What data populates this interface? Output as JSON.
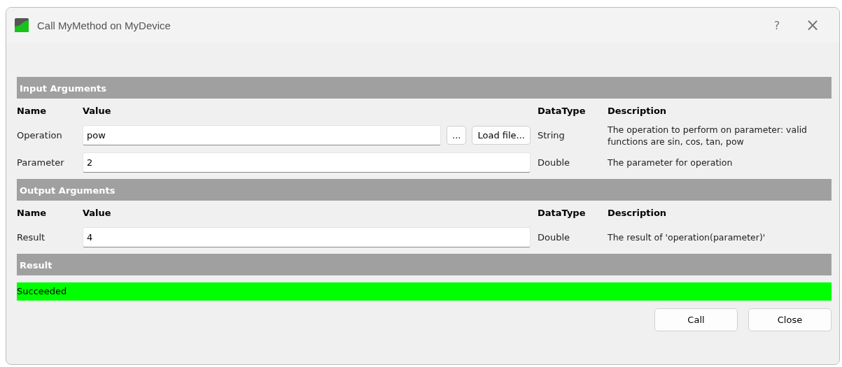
{
  "window": {
    "title": "Call MyMethod on MyDevice",
    "help": "?",
    "close": "×"
  },
  "sections": [
    {
      "title": "Input Arguments",
      "columns": [
        "Name",
        "Value",
        "DataType",
        "Description"
      ],
      "rows": [
        {
          "name": "Operation",
          "value": "pow",
          "buttons": [
            "...",
            "Load file..."
          ],
          "datatype": "String",
          "description": "The operation to perform on parameter: valid functions are sin, cos, tan, pow"
        },
        {
          "name": "Parameter",
          "value": "2",
          "datatype": "Double",
          "description": "The parameter for operation"
        }
      ]
    },
    {
      "title": "Output Arguments",
      "columns": [
        "Name",
        "Value",
        "DataType",
        "Description"
      ],
      "rows": [
        {
          "name": "Result",
          "value": "4",
          "datatype": "Double",
          "description": "The result of 'operation(parameter)'"
        }
      ]
    }
  ],
  "result": {
    "title": "Result",
    "text": "Succeeded",
    "succeeded": true
  },
  "buttons": [
    "Call",
    "Close"
  ]
}
